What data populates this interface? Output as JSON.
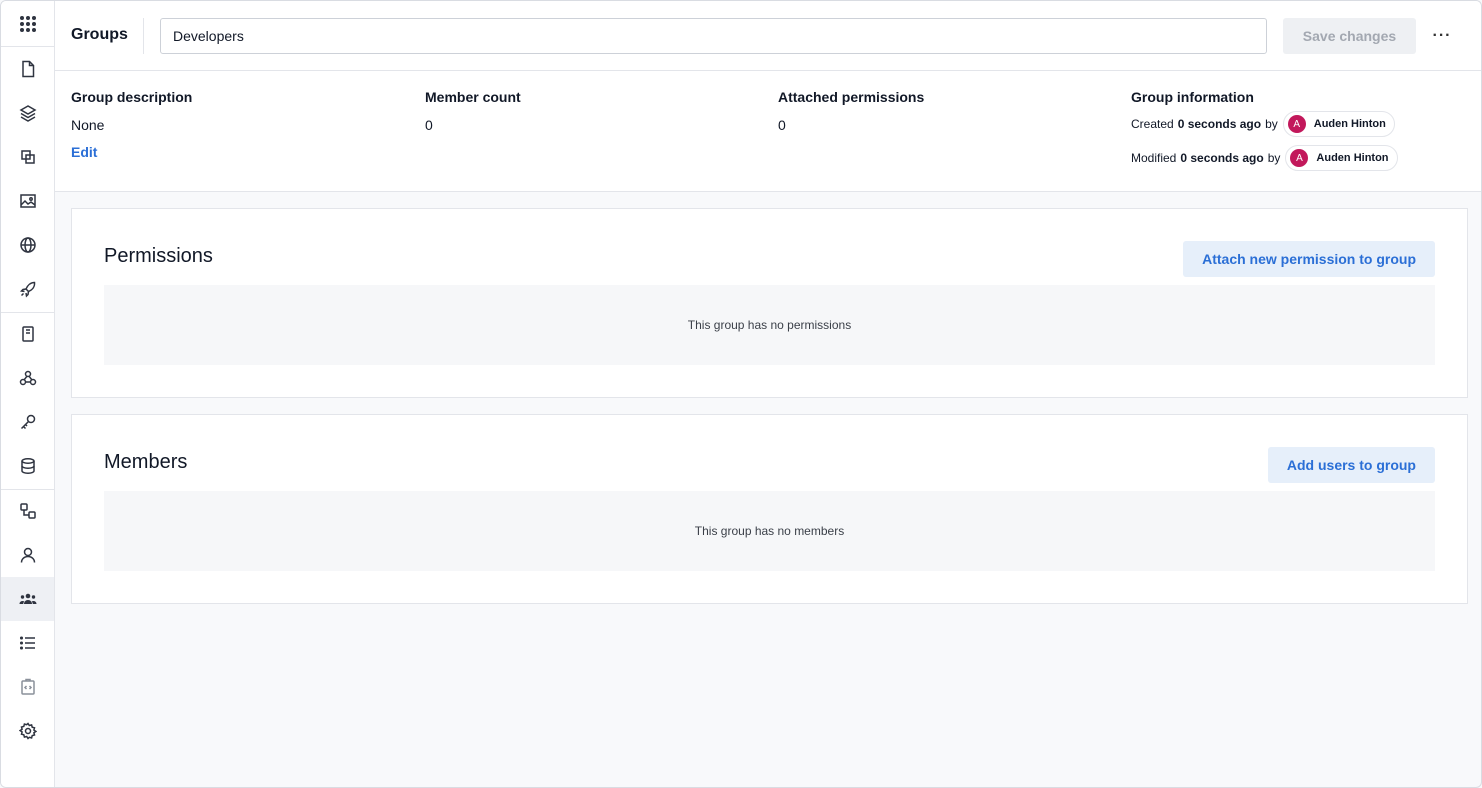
{
  "sidebar": {
    "icons": [
      "apps-grid-icon",
      "file-icon",
      "layers-icon",
      "copy-icon",
      "images-icon",
      "globe-icon",
      "rocket-icon",
      "book-icon",
      "webhook-icon",
      "key-icon",
      "database-icon",
      "flow-icon",
      "user-icon",
      "groups-icon",
      "list-icon",
      "code-icon",
      "gear-icon"
    ],
    "active": "groups-icon"
  },
  "header": {
    "title": "Groups",
    "group_name": "Developers",
    "save_label": "Save changes",
    "more_label": "···"
  },
  "info": {
    "description_label": "Group description",
    "description_value": "None",
    "edit_label": "Edit",
    "member_count_label": "Member count",
    "member_count_value": "0",
    "permissions_label": "Attached permissions",
    "permissions_value": "0",
    "group_info_label": "Group information",
    "created_prefix": "Created",
    "created_time": "0 seconds ago",
    "created_by": "by",
    "created_user": "Auden Hinton",
    "modified_prefix": "Modified",
    "modified_time": "0 seconds ago",
    "modified_by": "by",
    "modified_user": "Auden Hinton",
    "avatar_initial": "A"
  },
  "permissions": {
    "title": "Permissions",
    "button": "Attach new permission to group",
    "empty": "This group has no permissions"
  },
  "members": {
    "title": "Members",
    "button": "Add users to group",
    "empty": "This group has no members"
  },
  "colors": {
    "accent": "#2b6fd6",
    "avatar": "#c2185b"
  }
}
